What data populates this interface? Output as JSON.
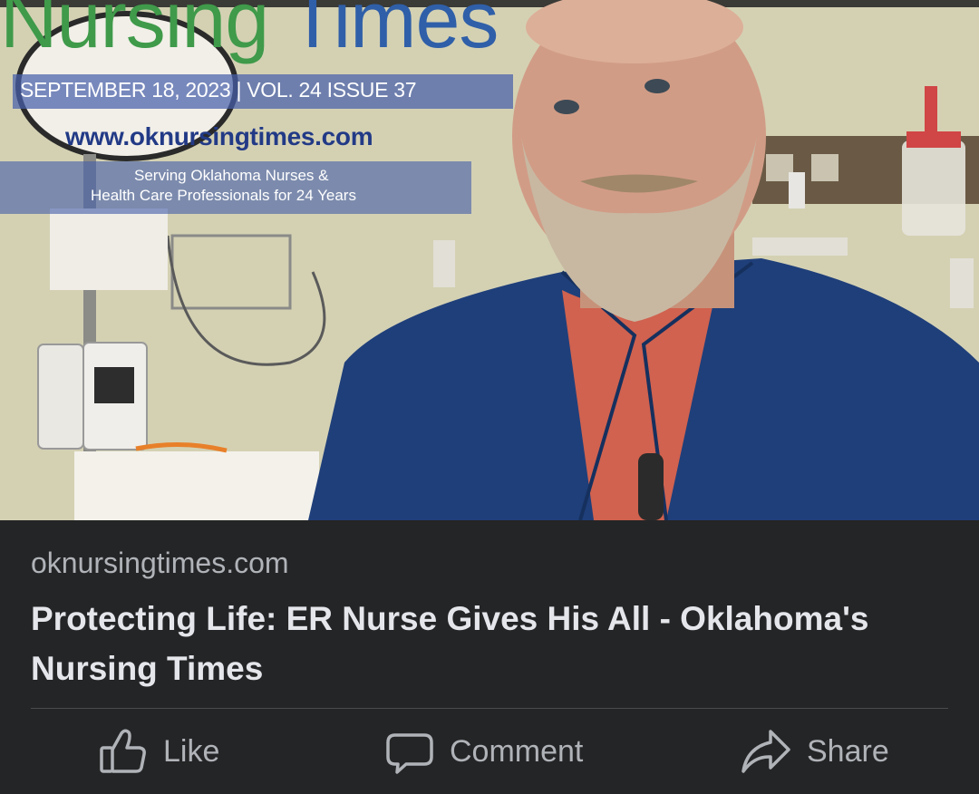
{
  "image": {
    "masthead_word1": "Nursing",
    "masthead_word2": "Times",
    "issue_line": "SEPTEMBER 18, 2023 | VOL. 24 ISSUE 37",
    "website": "www.oknursingtimes.com",
    "tagline_line1": "Serving Oklahoma Nurses &",
    "tagline_line2": "Health Care Professionals for 24 Years"
  },
  "preview": {
    "domain": "oknursingtimes.com",
    "title": "Protecting Life: ER Nurse Gives His All - Oklahoma's Nursing Times"
  },
  "actions": {
    "like_label": "Like",
    "comment_label": "Comment",
    "share_label": "Share"
  },
  "icons": {
    "like": "thumbs-up-icon",
    "comment": "comment-bubble-icon",
    "share": "share-arrow-icon"
  },
  "colors": {
    "card_background": "#242526",
    "title_text": "#e4e6eb",
    "secondary_text": "#b0b3b8"
  }
}
